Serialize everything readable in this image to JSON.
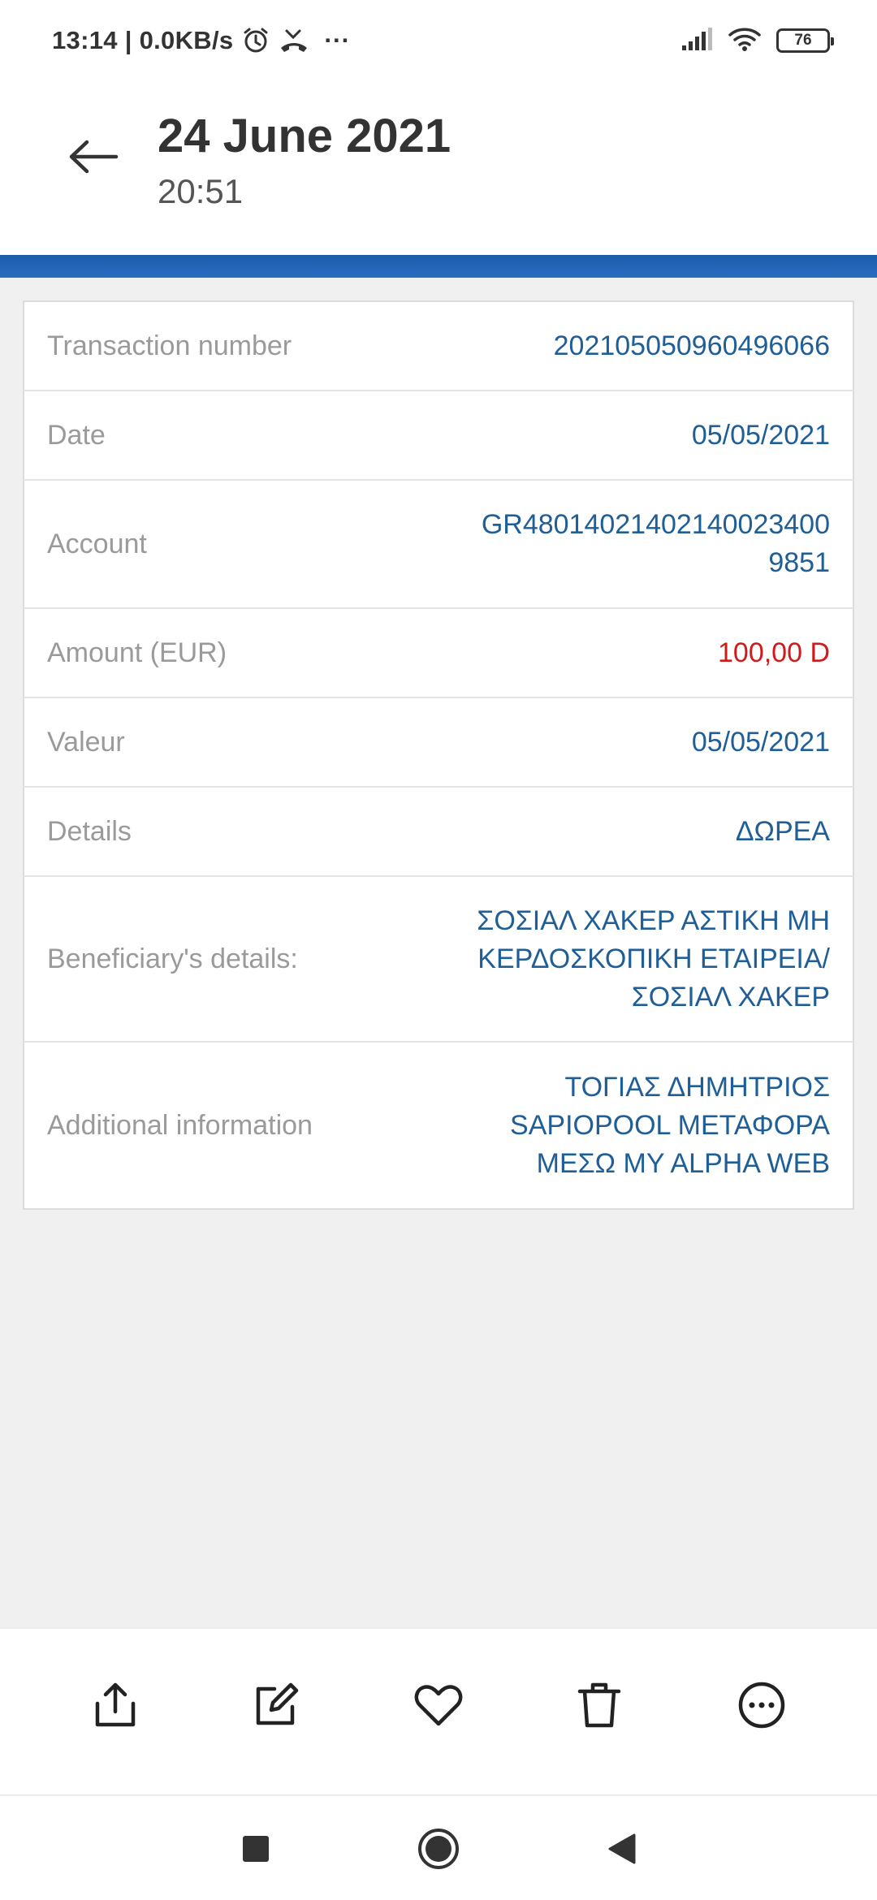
{
  "status_bar": {
    "time_speed": "13:14 | 0.0KB/s",
    "overflow_dots": "···",
    "battery": "76"
  },
  "header": {
    "title": "24 June 2021",
    "subtitle": "20:51"
  },
  "details": [
    {
      "label": "Transaction number",
      "value_lines": [
        "202105050960496066"
      ]
    },
    {
      "label": "Date",
      "value_lines": [
        "05/05/2021"
      ]
    },
    {
      "label": "Account",
      "value_lines": [
        "GR48014021402140023400",
        "9851"
      ]
    },
    {
      "label": "Amount (EUR)",
      "value_lines": [
        "100,00 D"
      ]
    },
    {
      "label": "Valeur",
      "value_lines": [
        "05/05/2021"
      ]
    },
    {
      "label": "Details",
      "value_lines": [
        "ΔΩΡΕΑ"
      ]
    },
    {
      "label": "Beneficiary's details:",
      "value_lines": [
        "ΣΟΣΙΑΛ ΧΑΚΕΡ ΑΣΤΙΚΗ ΜΗ",
        "ΚΕΡΔΟΣΚΟΠΙΚΗ ΕΤΑΙΡΕΙΑ/",
        "ΣΟΣΙΑΛ ΧΑΚΕΡ"
      ]
    },
    {
      "label": "Additional information",
      "value_lines": [
        "ΤΟΓΙΑΣ ΔΗΜΗΤΡΙΟΣ",
        "SAPIOPOOL ΜΕΤΑΦΟΡΑ",
        "ΜΕΣΩ MY ALPHA WEB"
      ]
    }
  ],
  "colors": {
    "header_strip": "#1b5bab",
    "value_text": "#1f5e96",
    "amount_debit": "#d01b1b",
    "label_text": "#9a9a9a"
  },
  "toolbar": {
    "icons": [
      "share-icon",
      "edit-icon",
      "favorite-icon",
      "delete-icon",
      "more-icon"
    ]
  },
  "nav": {
    "icons": [
      "recents-square-icon",
      "home-circle-icon",
      "back-triangle-icon"
    ]
  }
}
